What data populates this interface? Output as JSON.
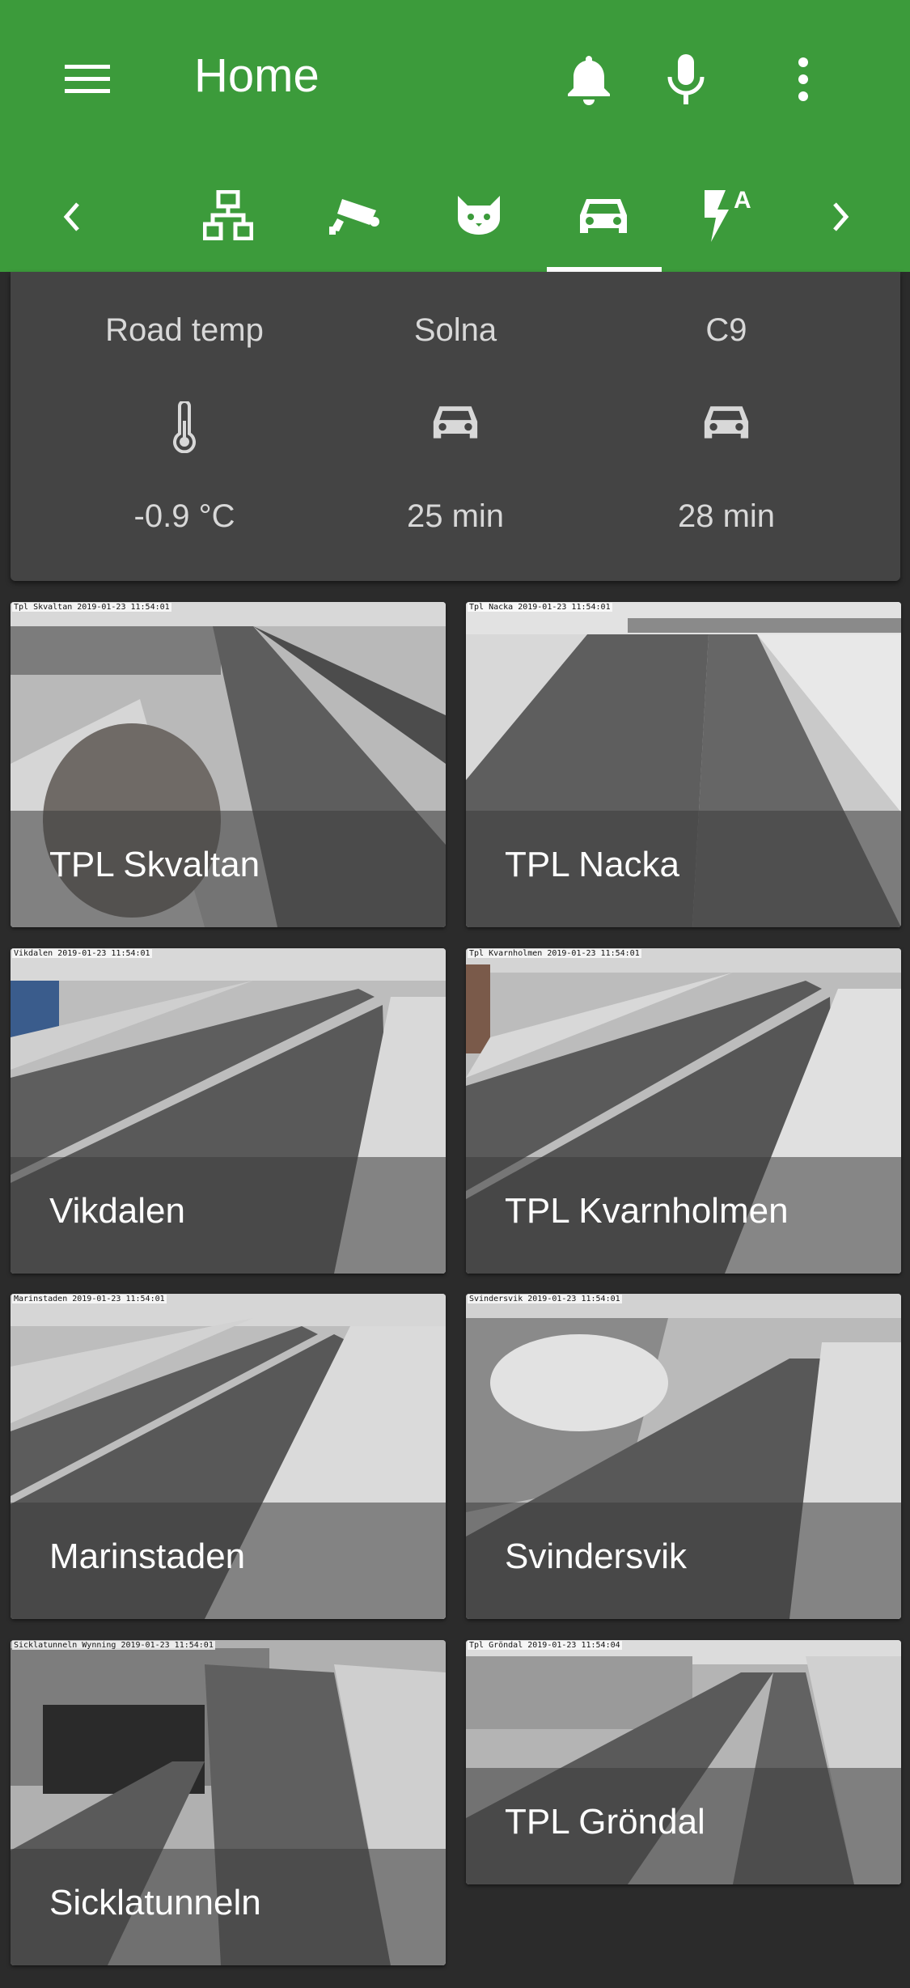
{
  "header": {
    "title": "Home",
    "icons": [
      "menu-icon",
      "bell-icon",
      "microphone-icon",
      "more-vert-icon"
    ]
  },
  "tabs": {
    "items": [
      "network-icon",
      "cctv-icon",
      "cat-icon",
      "car-icon",
      "flash-auto-icon"
    ],
    "active_index": 3,
    "nav": [
      "chevron-left-icon",
      "chevron-right-icon"
    ]
  },
  "glance": {
    "sensors": [
      {
        "name": "Road temp",
        "icon": "thermometer-icon",
        "state": "-0.9 °C"
      },
      {
        "name": "Solna",
        "icon": "car-icon",
        "state": "25 min"
      },
      {
        "name": "C9",
        "icon": "car-icon",
        "state": "28 min"
      }
    ]
  },
  "cameras": [
    {
      "name": "TPL Skvaltan",
      "stamp": "Tpl Skvaltan 2019-01-23 11:54:01"
    },
    {
      "name": "TPL Nacka",
      "stamp": "Tpl Nacka 2019-01-23 11:54:01"
    },
    {
      "name": "Vikdalen",
      "stamp": "Vikdalen 2019-01-23 11:54:01"
    },
    {
      "name": "TPL Kvarnholmen",
      "stamp": "Tpl Kvarnholmen 2019-01-23 11:54:01"
    },
    {
      "name": "Marinstaden",
      "stamp": "Marinstaden 2019-01-23 11:54:01"
    },
    {
      "name": "Svindersvik",
      "stamp": "Svindersvik 2019-01-23 11:54:01"
    },
    {
      "name": "Sicklatunneln",
      "stamp": "Sicklatunneln Wynning 2019-01-23 11:54:01"
    },
    {
      "name": "TPL Gröndal",
      "stamp": "Tpl Gröndal 2019-01-23 11:54:04"
    }
  ],
  "colors": {
    "app_bar": "#3c9b3b",
    "background": "#2b2b2b",
    "card": "#444444",
    "text": "#d8d8d8"
  }
}
